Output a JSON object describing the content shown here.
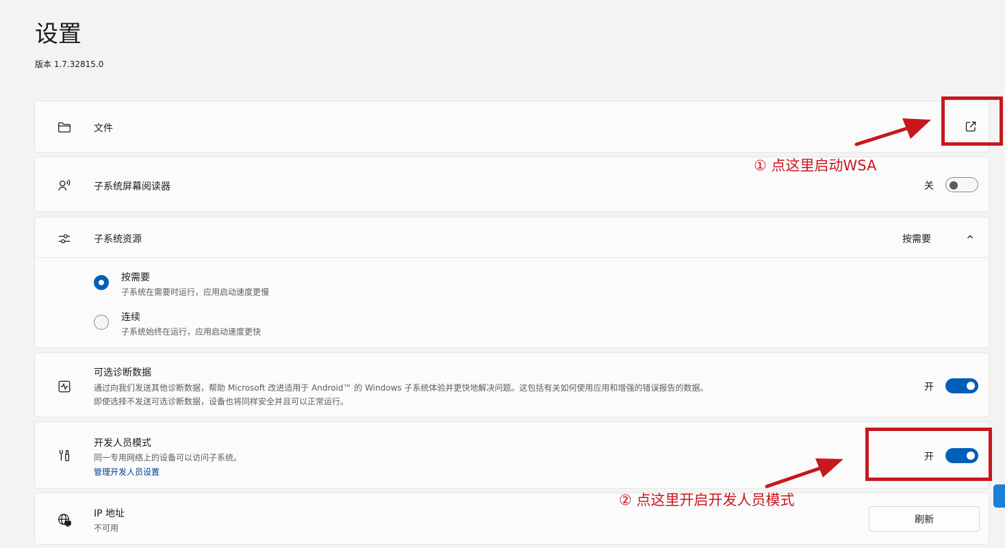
{
  "header": {
    "title": "设置",
    "version": "版本 1.7.32815.0"
  },
  "files": {
    "label": "文件",
    "icon": "folder-icon",
    "action_icon": "open-external-icon"
  },
  "screen_reader": {
    "label": "子系统屏幕阅读器",
    "icon": "narrator-icon",
    "state": "关",
    "toggle_on": false
  },
  "resources": {
    "label": "子系统资源",
    "icon": "sliders-icon",
    "selected_value": "按需要",
    "expanded": true,
    "options": [
      {
        "title": "按需要",
        "desc": "子系统在需要时运行，应用启动速度更慢",
        "selected": true
      },
      {
        "title": "连续",
        "desc": "子系统始终在运行，应用启动速度更快",
        "selected": false
      }
    ]
  },
  "diagnostics": {
    "label": "可选诊断数据",
    "icon": "pulse-icon",
    "desc_line1": "通过向我们发送其他诊断数据，帮助 Microsoft 改进适用于 Android™ 的 Windows 子系统体验并更快地解决问题。这包括有关如何使用应用和增强的错误报告的数据。",
    "desc_line2": "即使选择不发送可选诊断数据，设备也将同样安全并且可以正常运行。",
    "state": "开",
    "toggle_on": true
  },
  "developer": {
    "label": "开发人员模式",
    "icon": "tools-icon",
    "desc": "同一专用网络上的设备可以访问子系统。",
    "link": "管理开发人员设置",
    "state": "开",
    "toggle_on": true
  },
  "ip": {
    "label": "IP 地址",
    "icon": "globe-network-icon",
    "value": "不可用",
    "button": "刷新"
  },
  "annotations": {
    "note1": "① 点这里启动WSA",
    "note2": "② 点这里开启开发人员模式",
    "color": "#c8171e"
  },
  "colors": {
    "accent": "#005fb8",
    "background": "#f3f3f3",
    "card": "#fbfbfb"
  }
}
